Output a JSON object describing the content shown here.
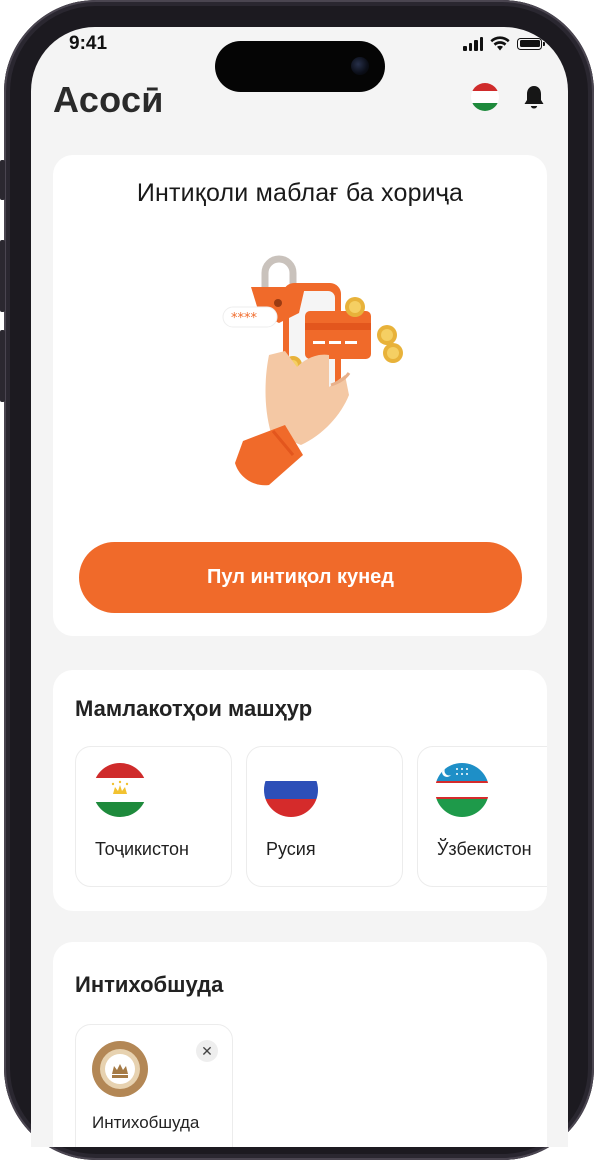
{
  "status_bar": {
    "time": "9:41"
  },
  "header": {
    "title": "Асосӣ"
  },
  "hero": {
    "title": "Интиқоли маблағ ба хориҷа",
    "button_label": "Пул интиқол кунед"
  },
  "popular": {
    "title": "Мамлакотҳои машҳур",
    "countries": [
      {
        "name": "Тоҷикистон"
      },
      {
        "name": "Русия"
      },
      {
        "name": "Ўзбекистон"
      }
    ]
  },
  "selected": {
    "title": "Интихобшуда",
    "items": [
      {
        "name": "Интихобшуда"
      }
    ]
  },
  "colors": {
    "accent": "#f06a2a",
    "background": "#f4f4f4",
    "card": "#ffffff"
  },
  "icons": [
    "signal-icon",
    "wifi-icon",
    "battery-icon",
    "tajikistan-flag-icon",
    "bell-icon",
    "close-icon",
    "emblem-icon"
  ]
}
